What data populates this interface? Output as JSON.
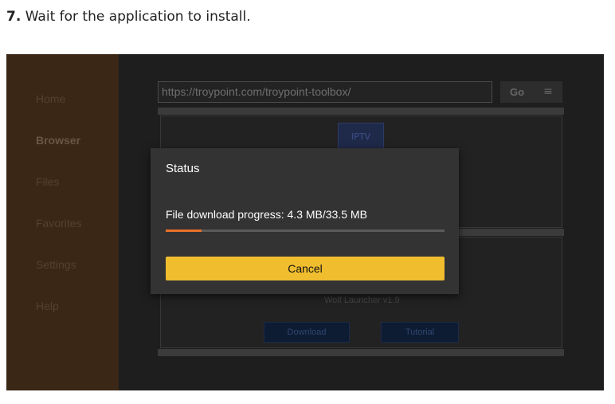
{
  "instruction": {
    "number": "7.",
    "text": "Wait for the application to install."
  },
  "sidebar": {
    "items": [
      {
        "label": "Home"
      },
      {
        "label": "Browser"
      },
      {
        "label": "Files"
      },
      {
        "label": "Favorites"
      },
      {
        "label": "Settings"
      },
      {
        "label": "Help"
      }
    ],
    "active_index": 1
  },
  "browser": {
    "url": "https://troypoint.com/troypoint-toolbox/",
    "go_label": "Go",
    "menu_icon": "menu-icon",
    "app_icon": "iptv-app-icon",
    "app_icon_text": "IPTV",
    "app_name": "Wolf Launcher v1.9",
    "download_label": "Download",
    "tutorial_label": "Tutorial"
  },
  "dialog": {
    "title": "Status",
    "progress_text": "File download progress: 4.3 MB/33.5 MB",
    "progress_fraction": 0.128,
    "cancel_label": "Cancel"
  },
  "colors": {
    "accent_button": "#f0bd2f",
    "progress_fill": "#e8712a",
    "sidebar_bg": "#3a2716"
  }
}
